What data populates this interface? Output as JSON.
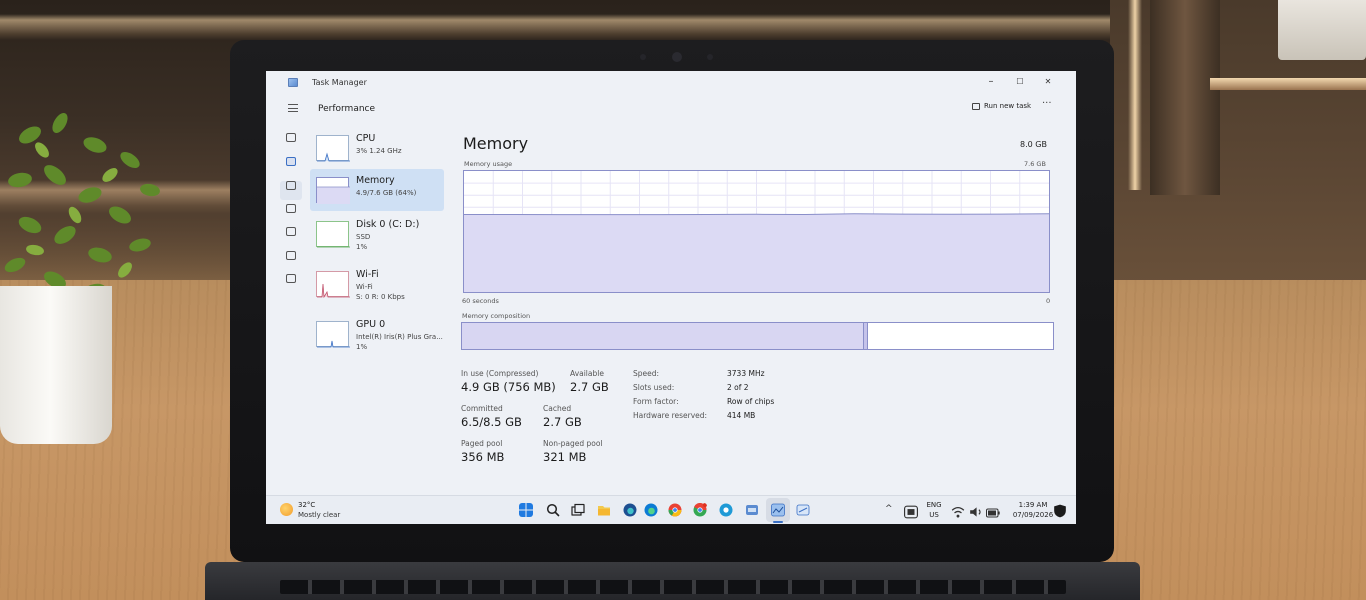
{
  "window": {
    "title": "Task Manager",
    "minimize": "–",
    "maximize": "☐",
    "close": "✕"
  },
  "header": {
    "page_title": "Performance",
    "run_new_task": "Run new task",
    "more": "···"
  },
  "sidebar": {
    "items": [
      {
        "name": "CPU",
        "line1": "3%  1.24 GHz",
        "line2": ""
      },
      {
        "name": "Memory",
        "line1": "4.9/7.6 GB (64%)",
        "line2": ""
      },
      {
        "name": "Disk 0 (C: D:)",
        "line1": "SSD",
        "line2": "1%"
      },
      {
        "name": "Wi-Fi",
        "line1": "Wi-Fi",
        "line2": "S: 0  R: 0 Kbps"
      },
      {
        "name": "GPU 0",
        "line1": "Intel(R) Iris(R) Plus Gra...",
        "line2": "1%"
      }
    ]
  },
  "memory": {
    "title": "Memory",
    "total": "8.0 GB",
    "usage_label": "Memory usage",
    "usage_max": "7.6 GB",
    "axis_left": "60 seconds",
    "axis_right": "0",
    "composition_label": "Memory composition",
    "in_use_label": "In use (Compressed)",
    "in_use_value": "4.9 GB (756 MB)",
    "available_label": "Available",
    "available_value": "2.7 GB",
    "committed_label": "Committed",
    "committed_value": "6.5/8.5 GB",
    "cached_label": "Cached",
    "cached_value": "2.7 GB",
    "paged_label": "Paged pool",
    "paged_value": "356 MB",
    "nonpaged_label": "Non-paged pool",
    "nonpaged_value": "321 MB",
    "specs": [
      {
        "label": "Speed:",
        "value": "3733 MHz"
      },
      {
        "label": "Slots used:",
        "value": "2 of 2"
      },
      {
        "label": "Form factor:",
        "value": "Row of chips"
      },
      {
        "label": "Hardware reserved:",
        "value": "414 MB"
      }
    ],
    "composition": {
      "in_use_fraction": 0.68,
      "modified_fraction": 0.006
    }
  },
  "chart_data": {
    "type": "area",
    "x": [
      60,
      55,
      50,
      45,
      40,
      35,
      30,
      25,
      20,
      15,
      10,
      5,
      0
    ],
    "values": [
      4.87,
      4.87,
      4.86,
      4.86,
      4.86,
      4.87,
      4.88,
      4.87,
      4.91,
      4.89,
      4.88,
      4.89,
      4.92
    ],
    "ylim": [
      0,
      7.6
    ],
    "xlim": [
      60,
      0
    ],
    "xlabel": "60 seconds",
    "ylabel": "Memory usage",
    "grid": true,
    "color": "#8a8fc9",
    "fill": "#dcdaf4"
  },
  "taskbar": {
    "weather_temp": "32°C",
    "weather_desc": "Mostly clear",
    "lang_top": "ENG",
    "lang_bottom": "US",
    "time": "1:39 AM",
    "date": "07/09/2026",
    "chevron": "^"
  },
  "icons": {
    "start": "windows-icon",
    "search": "search-icon",
    "task_view": "task-view-icon",
    "explorer": "folder-icon",
    "edge_dev": "edge-dev-icon",
    "edge": "edge-icon",
    "chrome": "chrome-icon",
    "chrome_alt": "chrome-alt-icon",
    "telegram": "telegram-icon",
    "app_bg": "app-icon",
    "task_manager": "task-manager-icon",
    "app_blue": "app-blue-icon"
  },
  "colors": {
    "accent": "#3a6fc4",
    "memory_line": "#8a8fc9",
    "memory_fill": "#dcdaf4",
    "selected_item": "#cfe0f4"
  }
}
